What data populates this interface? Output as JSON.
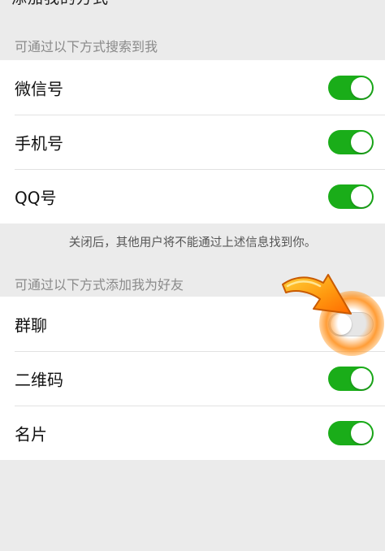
{
  "header": {
    "cut_title": "添加我的方式"
  },
  "search_section": {
    "title": "可通过以下方式搜索到我",
    "items": [
      {
        "label": "微信号",
        "enabled": true
      },
      {
        "label": "手机号",
        "enabled": true
      },
      {
        "label": "QQ号",
        "enabled": true
      }
    ],
    "note": "关闭后，其他用户将不能通过上述信息找到你。"
  },
  "add_section": {
    "title": "可通过以下方式添加我为好友",
    "items": [
      {
        "label": "群聊",
        "enabled": false
      },
      {
        "label": "二维码",
        "enabled": true
      },
      {
        "label": "名片",
        "enabled": true
      }
    ]
  },
  "colors": {
    "toggle_on": "#1aad19",
    "toggle_off": "#e6e6e6",
    "background": "#ebebeb",
    "highlight_arrow": "#ff8a00"
  }
}
